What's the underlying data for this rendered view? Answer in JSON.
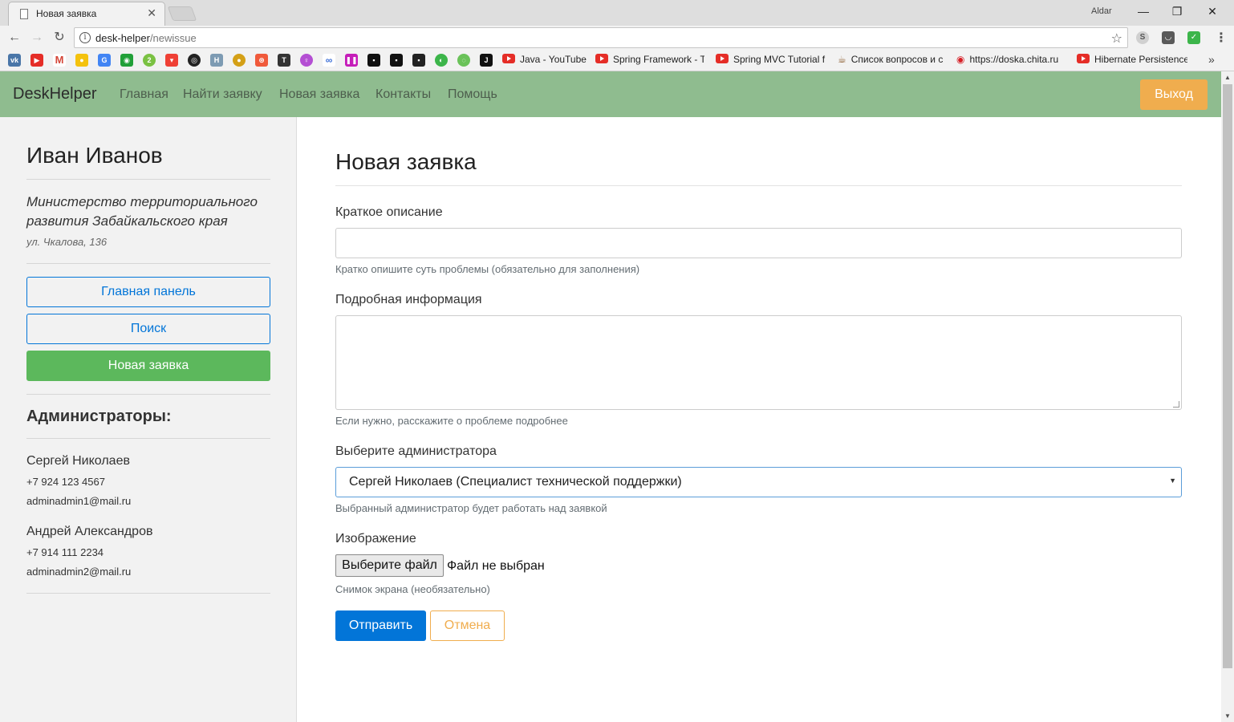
{
  "browser": {
    "tab_title": "Новая заявка",
    "user": "Aldar",
    "url_host": "desk-helper",
    "url_path": "/newissue",
    "bookmarks": [
      {
        "label": "Java - YouTube"
      },
      {
        "label": "Spring Framework - T"
      },
      {
        "label": "Spring MVC Tutorial f"
      },
      {
        "label": "Список вопросов и с"
      },
      {
        "label": "https://doska.chita.ru"
      },
      {
        "label": "Hibernate Persistence"
      }
    ],
    "more": "»"
  },
  "navbar": {
    "brand": "DeskHelper",
    "links": [
      "Главная",
      "Найти заявку",
      "Новая заявка",
      "Контакты",
      "Помощь"
    ],
    "logout": "Выход"
  },
  "sidebar": {
    "user_name": "Иван Иванов",
    "organization": "Министерство территориального развития Забайкальского края",
    "address": "ул. Чкалова, 136",
    "buttons": [
      "Главная панель",
      "Поиск",
      "Новая заявка"
    ],
    "admins_title": "Администраторы:",
    "admins": [
      {
        "name": "Сергей Николаев",
        "phone": "+7 924 123 4567",
        "email": "adminadmin1@mail.ru"
      },
      {
        "name": "Андрей Александров",
        "phone": "+7 914 111 2234",
        "email": "adminadmin2@mail.ru"
      }
    ]
  },
  "form": {
    "title": "Новая заявка",
    "short_label": "Краткое описание",
    "short_help": "Кратко опишите суть проблемы (обязательно для заполнения)",
    "details_label": "Подробная информация",
    "details_help": "Если нужно, расскажите о проблеме подробнее",
    "admin_label": "Выберите администратора",
    "admin_selected": "Сергей Николаев (Специалист технической поддержки)",
    "admin_help": "Выбранный администратор будет работать над заявкой",
    "image_label": "Изображение",
    "file_button": "Выберите файл",
    "file_status": "Файл не выбран",
    "image_help": "Снимок экрана (необязательно)",
    "submit": "Отправить",
    "cancel": "Отмена"
  },
  "colors": {
    "navbar": "#8fbc8f",
    "primary": "#0275d8",
    "success": "#5cb85c",
    "warning": "#f0ad4e"
  }
}
